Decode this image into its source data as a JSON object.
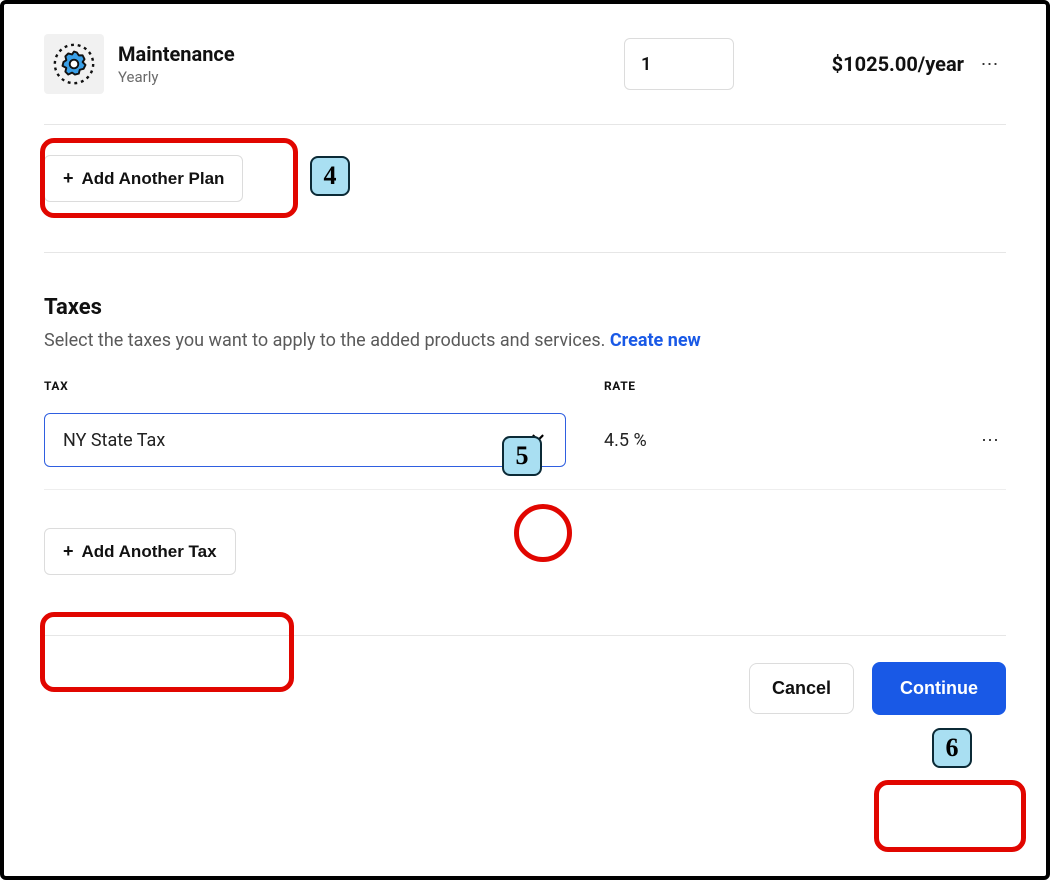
{
  "plan": {
    "icon_name": "gear-icon",
    "title": "Maintenance",
    "subtitle": "Yearly",
    "quantity": "1",
    "price": "$1025.00/year",
    "more_glyph": "⋯"
  },
  "add_plan": {
    "plus_glyph": "+",
    "label": "Add Another Plan"
  },
  "taxes": {
    "title": "Taxes",
    "description_prefix": "Select the taxes you want to apply to the added products and services. ",
    "create_new_label": "Create new",
    "headers": {
      "tax": "TAX",
      "rate": "RATE"
    },
    "row": {
      "name": "NY State Tax",
      "chevron_glyph": "⌄",
      "rate": "4.5 %",
      "more_glyph": "⋯"
    },
    "add_tax": {
      "plus_glyph": "+",
      "label": "Add Another Tax"
    }
  },
  "footer": {
    "cancel_label": "Cancel",
    "continue_label": "Continue"
  },
  "annotations": {
    "badge_4": "4",
    "badge_5": "5",
    "badge_6": "6"
  }
}
